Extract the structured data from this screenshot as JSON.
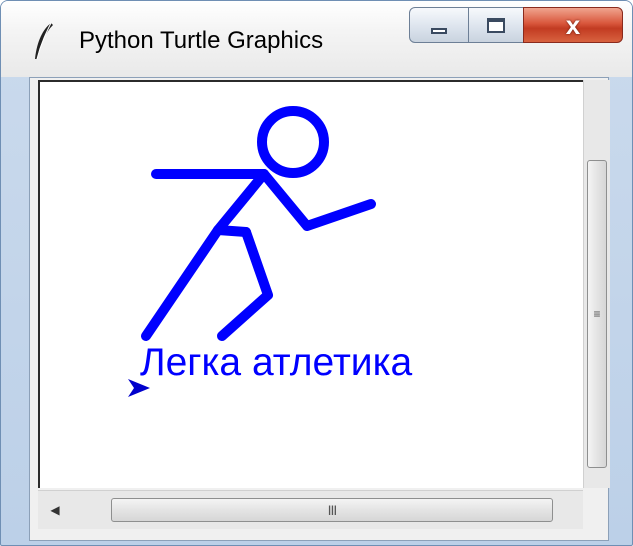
{
  "window": {
    "title": "Python Turtle Graphics",
    "icon": "feather-icon"
  },
  "controls": {
    "minimize_icon": "minimize-icon",
    "maximize_icon": "restore-icon",
    "close_glyph": "x"
  },
  "canvas": {
    "caption": "Легка атлетика",
    "ink_color": "#0000ff",
    "background": "#ffffff",
    "figure": "stick-figure-runner",
    "cursor_icon": "turtle-arrow-icon"
  },
  "scrollbars": {
    "vertical_grip": "≡",
    "horizontal_grip": "III",
    "left_arrow": "◀"
  }
}
